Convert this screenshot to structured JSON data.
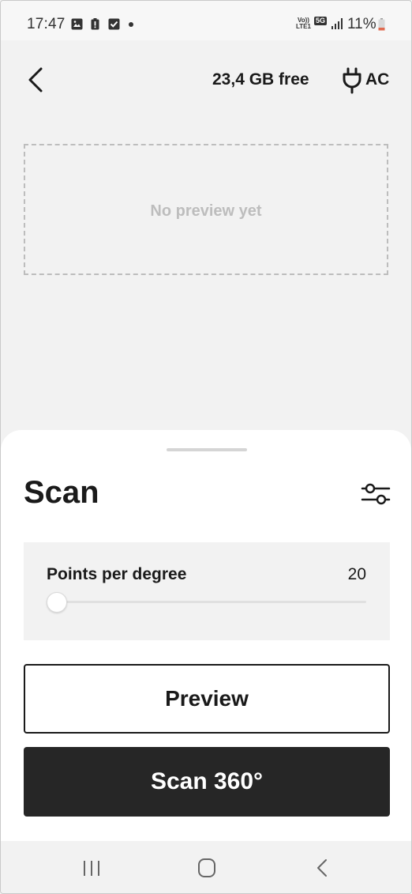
{
  "status_bar": {
    "time": "17:47",
    "icons": [
      "gallery-icon",
      "alert-battery-icon",
      "checkbox-icon",
      "dot-icon"
    ],
    "volte_line1": "Vo))",
    "volte_line2": "LTE1",
    "network": "5G",
    "battery": "11%"
  },
  "top_bar": {
    "back_icon": "chevron-left-icon",
    "storage": "23,4 GB free",
    "power_icon": "plug-icon",
    "power": "AC"
  },
  "preview": {
    "empty_text": "No preview yet"
  },
  "sheet": {
    "title": "Scan",
    "settings_icon": "sliders-icon",
    "slider": {
      "label": "Points per degree",
      "value": "20",
      "fraction": 0
    },
    "preview_button": "Preview",
    "scan_button": "Scan 360°"
  },
  "nav_bar": {
    "icons": [
      "recent-apps-icon",
      "home-icon",
      "back-icon"
    ]
  },
  "colors": {
    "background": "#f2f2f2",
    "sheet": "#ffffff",
    "primary_button": "#262626",
    "placeholder_text": "#bdbdbd"
  }
}
